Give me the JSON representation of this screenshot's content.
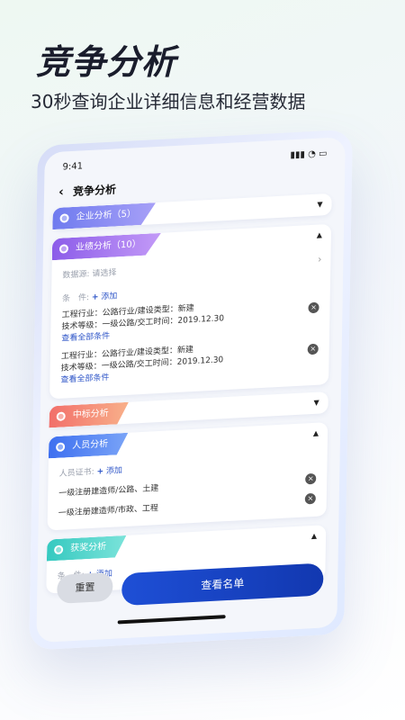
{
  "hero": {
    "title": "竞争分析",
    "subtitle": "30秒查询企业详细信息和经营数据"
  },
  "status": {
    "time": "9:41",
    "icons": "▮▮▮ ◔ ▭"
  },
  "nav": {
    "back_icon": "‹",
    "title": "竞争分析"
  },
  "sections": {
    "enterprise": {
      "label": "企业分析（5）",
      "caret": "▼"
    },
    "performance": {
      "label": "业绩分析（10）",
      "caret": "▲",
      "source_label": "数据源:",
      "source_placeholder": "请选择",
      "cond_label": "条　件:",
      "add_label": "添加",
      "items": [
        {
          "line1": "工程行业：公路行业/建设类型：新建",
          "line2": "技术等级：一级公路/交工时间：2019.12.30",
          "more": "查看全部条件"
        },
        {
          "line1": "工程行业：公路行业/建设类型：新建",
          "line2": "技术等级：一级公路/交工时间：2019.12.30",
          "more": "查看全部条件"
        }
      ]
    },
    "bid": {
      "label": "中标分析",
      "caret": "▼"
    },
    "personnel": {
      "label": "人员分析",
      "caret": "▲",
      "cert_label": "人员证书:",
      "add_label": "添加",
      "items": [
        "一级注册建造师/公路、土建",
        "一级注册建造师/市政、工程"
      ]
    },
    "award": {
      "label": "获奖分析",
      "caret": "▲",
      "cond_label": "条　件:",
      "add_label": "添加"
    }
  },
  "buttons": {
    "reset": "重置",
    "view": "查看名单"
  },
  "colors": {
    "enterprise": "#7d83f0",
    "performance": "#9a6cf0",
    "bid": "#f47f70",
    "personnel": "#4a7ff0",
    "award": "#3fd0c8",
    "primary": "#1e4fd6"
  }
}
